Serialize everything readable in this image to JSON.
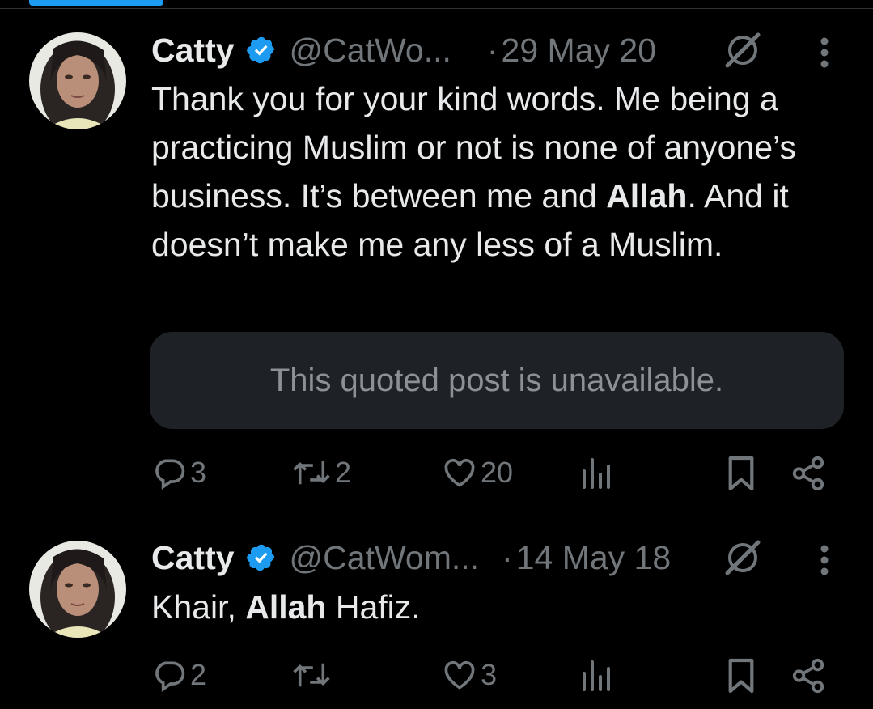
{
  "colors": {
    "background": "#000000",
    "text": "#e7e9ea",
    "muted": "#71767b",
    "accent": "#1d9bf0",
    "quote_bg": "#1e2125"
  },
  "tweets": [
    {
      "name": "Catty",
      "handle": "@CatWo...",
      "dot": "·",
      "date": "29 May 20",
      "text_parts": [
        "Thank you for your kind words. Me being a practicing Muslim or not is none of anyone’s business. It’s between me and ",
        "Allah",
        ". And it doesn’t make me any less of a Muslim."
      ],
      "quote": "This quoted post is unavailable.",
      "replies": "3",
      "reposts": "2",
      "likes": "20",
      "views": ""
    },
    {
      "name": "Catty",
      "handle": "@CatWom...",
      "dot": "·",
      "date": "14 May 18",
      "text_parts": [
        "Khair, ",
        "Allah",
        " Hafiz."
      ],
      "replies": "2",
      "reposts": "",
      "likes": "3",
      "views": ""
    }
  ],
  "icons": [
    "verified-badge-icon",
    "grok-icon",
    "more-options-icon",
    "reply-icon",
    "repost-icon",
    "like-icon",
    "views-icon",
    "bookmark-icon",
    "share-icon"
  ]
}
